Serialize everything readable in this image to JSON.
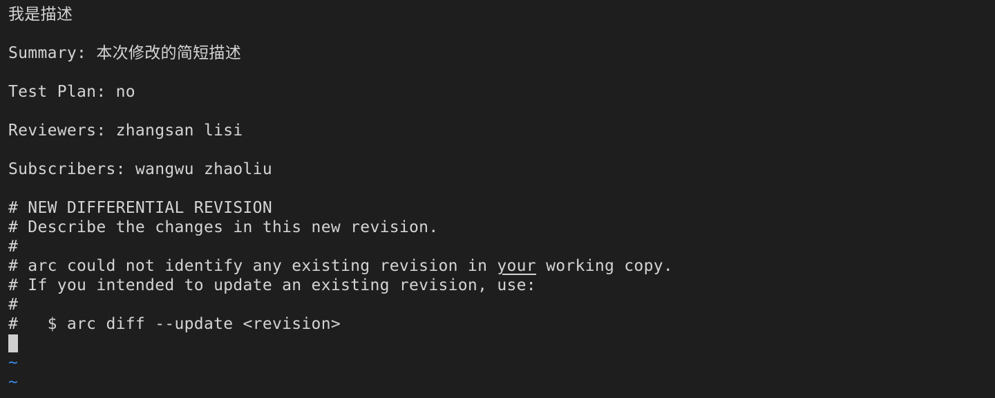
{
  "editor": {
    "lines": [
      "我是描述",
      "",
      "Summary: 本次修改的简短描述",
      "",
      "Test Plan: no",
      "",
      "Reviewers: zhangsan lisi",
      "",
      "Subscribers: wangwu zhaoliu",
      "",
      "# NEW DIFFERENTIAL REVISION",
      "# Describe the changes in this new revision.",
      "#"
    ],
    "arc_line": {
      "before": "# arc could not identify any existing revision in ",
      "underlined": "your",
      "after": " working copy."
    },
    "lines_after": [
      "# If you intended to update an existing revision, use:",
      "#",
      "#   $ arc diff --update <revision>"
    ],
    "empty_line_markers": [
      "~",
      "~"
    ]
  }
}
